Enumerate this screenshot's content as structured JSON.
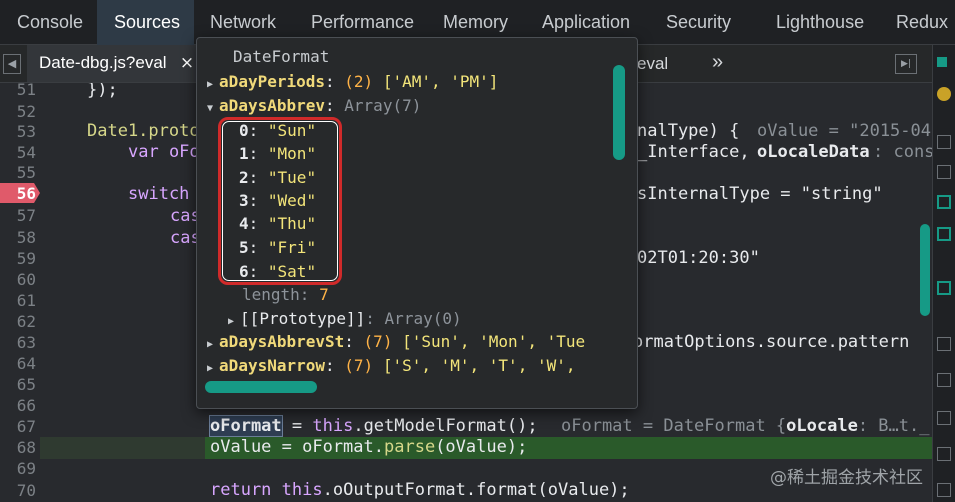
{
  "devtools_tabs": [
    "Console",
    "Sources",
    "Network",
    "Performance",
    "Memory",
    "Application",
    "Security",
    "Lighthouse",
    "Redux"
  ],
  "file_tab": {
    "name": "Date-dbg.js?eval",
    "close": "×"
  },
  "nav": {
    "back": "◀",
    "more": "»",
    "panel_toggle": "▶|"
  },
  "second_tab_text": "eval",
  "breakpoint_line": "56",
  "line_numbers": [
    "51",
    "52",
    "53",
    "54",
    "55",
    "56",
    "57",
    "58",
    "59",
    "60",
    "61",
    "62",
    "63",
    "64",
    "65",
    "66",
    "67",
    "68",
    "69",
    "70"
  ],
  "code": {
    "l51": "});",
    "l53_a": "Date1.proto",
    "l53_b": "nalType) {",
    "l53_c": "oValue = \"2015-04",
    "l54_a": "var oFo",
    "l54_b": "_Interface,",
    "l54_c": "oLocaleData",
    "l54_d": ": cons",
    "l56_a": "switch",
    "l56_b": "sInternalType = \"string\"",
    "l57": "cas",
    "l58": "cas",
    "l59": "02T01:20:30\"",
    "l63": "ormatOptions.source.pattern",
    "l67_a": "oFormat",
    "l67_b": " = ",
    "l67_c": "this",
    "l67_d": ".getModelFormat();",
    "l67_e": "oFormat = DateFormat {",
    "l67_f": "oLocale",
    "l67_g": ": B…t._",
    "l68_a": "oValue = oFormat.",
    "l68_b": "parse",
    "l68_c": "(oValue);",
    "l70_a": "return ",
    "l70_b": "this",
    "l70_c": ".oOutputFormat.format(oValue);"
  },
  "popup": {
    "title": "DateFormat",
    "rows": [
      {
        "key": "aDayPeriods",
        "count": "(2)",
        "value": "['AM', 'PM']"
      },
      {
        "key": "aDaysAbbrev",
        "type": "Array(7)"
      },
      {
        "key": "aDaysAbbrevSt",
        "count": "(7)",
        "value": "['Sun', 'Mon', 'Tue"
      },
      {
        "key": "aDaysNarrow",
        "count": "(7)",
        "value": "['S', 'M', 'T', 'W',"
      }
    ],
    "items": [
      {
        "index": "0",
        "value": "\"Sun\""
      },
      {
        "index": "1",
        "value": "\"Mon\""
      },
      {
        "index": "2",
        "value": "\"Tue\""
      },
      {
        "index": "3",
        "value": "\"Wed\""
      },
      {
        "index": "4",
        "value": "\"Thu\""
      },
      {
        "index": "5",
        "value": "\"Fri\""
      },
      {
        "index": "6",
        "value": "\"Sat\""
      }
    ],
    "length_key": "length",
    "length_val": "7",
    "proto_key": "[[Prototype]]",
    "proto_val": "Array(0)"
  },
  "watermark": "@稀土掘金技术社区",
  "colors": {
    "accent": "#169a86",
    "highlight_box": "#d02a2a",
    "breakpoint": "#e05a6a"
  }
}
